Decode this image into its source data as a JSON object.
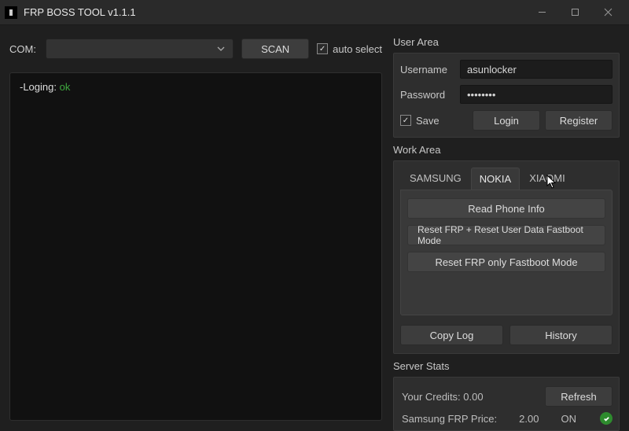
{
  "window": {
    "title": "FRP BOSS TOOL v1.1.1"
  },
  "com": {
    "label": "COM:",
    "scan_label": "SCAN",
    "auto_select_label": "auto select",
    "auto_select_checked": true
  },
  "log": {
    "prefix": "-Loging: ",
    "status": "ok"
  },
  "user_area": {
    "title": "User Area",
    "username_label": "Username",
    "username_value": "asunlocker",
    "password_label": "Password",
    "password_value": "••••••••",
    "save_label": "Save",
    "save_checked": true,
    "login_label": "Login",
    "register_label": "Register"
  },
  "work_area": {
    "title": "Work Area",
    "tabs": [
      {
        "label": "SAMSUNG",
        "active": false
      },
      {
        "label": "NOKIA",
        "active": true
      },
      {
        "label": "XIAOMI",
        "active": false
      }
    ],
    "actions": [
      "Read Phone Info",
      "Reset FRP + Reset User Data  Fastboot Mode",
      "Reset FRP only Fastboot Mode"
    ],
    "copy_log_label": "Copy Log",
    "history_label": "History"
  },
  "server_stats": {
    "title": "Server Stats",
    "credits_label": "Your Credits: ",
    "credits_value": "0.00",
    "refresh_label": "Refresh",
    "samsung_price_label": "Samsung FRP Price:",
    "samsung_price_value": "2.00",
    "samsung_price_status": "ON"
  }
}
